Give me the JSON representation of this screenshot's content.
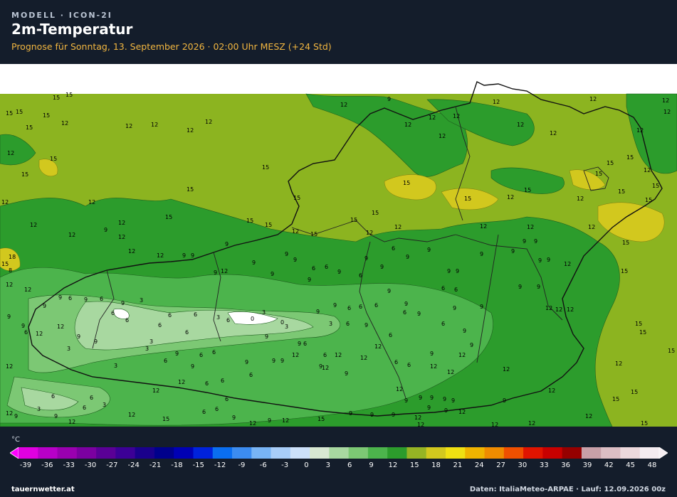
{
  "header": {
    "kicker": "MODELL · ICON-2I",
    "title": "2m-Temperatur",
    "subtitle": "Prognose für Sonntag, 13. September 2026 · 02:00 Uhr MESZ  (+24 Std)"
  },
  "legend": {
    "unit": "°C",
    "ticks": [
      "-39",
      "-36",
      "-33",
      "-30",
      "-27",
      "-24",
      "-21",
      "-18",
      "-15",
      "-12",
      "-9",
      "-6",
      "-3",
      "0",
      "3",
      "6",
      "9",
      "12",
      "15",
      "18",
      "21",
      "24",
      "27",
      "30",
      "33",
      "36",
      "39",
      "42",
      "45",
      "48"
    ],
    "colors": [
      "#e000e0",
      "#b800c8",
      "#9a00b0",
      "#7b00a0",
      "#5a0096",
      "#3c0096",
      "#1a008c",
      "#00008c",
      "#0000b4",
      "#0022dc",
      "#0a6ef0",
      "#3c8cf0",
      "#78b4f5",
      "#a8cdf8",
      "#cde1fa",
      "#d8e8d2",
      "#a8d8a0",
      "#7cc874",
      "#4cb44c",
      "#2c9c2c",
      "#96b424",
      "#d2c81e",
      "#f0e012",
      "#f0b400",
      "#f08c00",
      "#f05000",
      "#e01400",
      "#c80000",
      "#960000",
      "#c8a0a8",
      "#dcbec4",
      "#ecd8dc",
      "#f4ecf0"
    ]
  },
  "map": {
    "colors": {
      "band_12_15": "#8cb420",
      "band_15_18": "#d2c81e",
      "band_9_12": "#2c9c2c",
      "band_6_9": "#4cb44c",
      "band_3_6": "#7cc874",
      "band_0_3": "#a8d8a0",
      "band_below_0": "#ffffff"
    },
    "labels": [
      "15",
      "12",
      "9",
      "6",
      "3",
      "0",
      "18"
    ]
  },
  "footer": {
    "site": "tauernwetter.at",
    "credits": "Daten: ItaliaMeteo-ARPAE · Lauf: 12.09.2026 00z"
  }
}
